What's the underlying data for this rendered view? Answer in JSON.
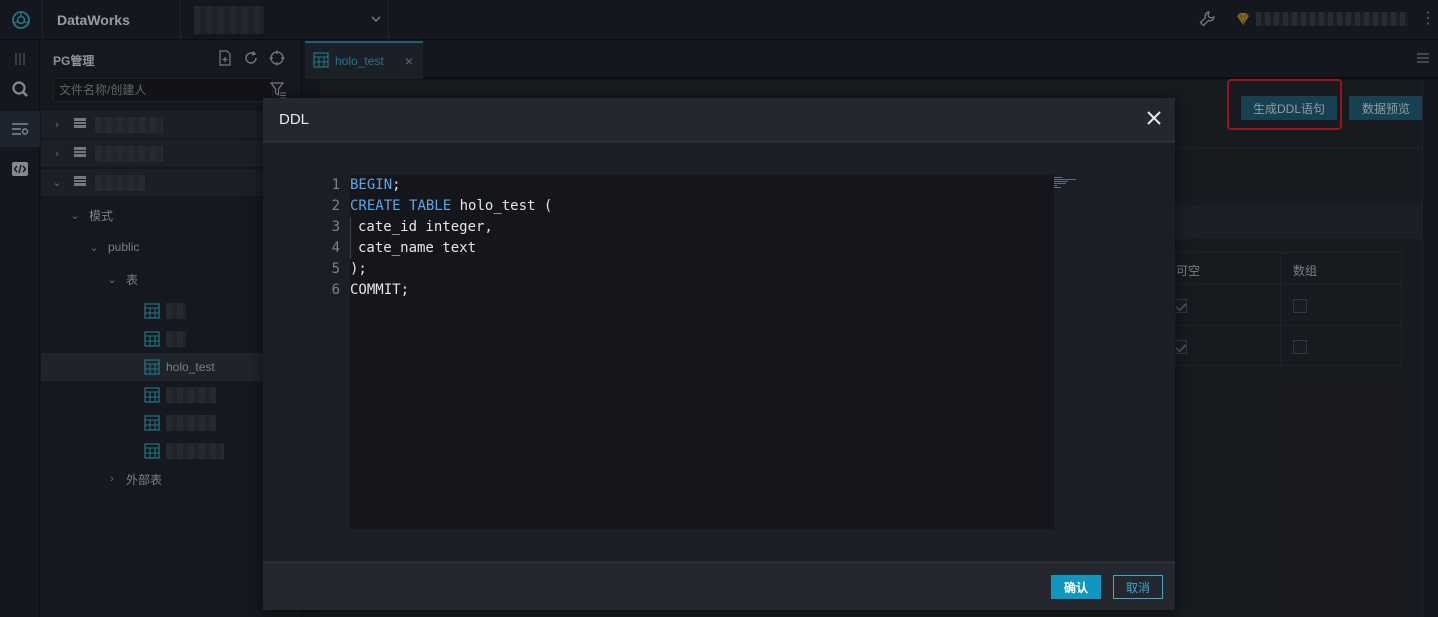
{
  "app": {
    "title": "DataWorks"
  },
  "panel": {
    "title": "PG管理",
    "search_placeholder": "文件名称/创建人",
    "tree": {
      "schema_label": "模式",
      "public_label": "public",
      "tables_label": "表",
      "selected_table": "holo_test",
      "external_label": "外部表"
    }
  },
  "tabs": [
    {
      "label": "holo_test"
    }
  ],
  "toolbar": {
    "generate_ddl_label": "生成DDL语句",
    "data_preview_label": "数据预览"
  },
  "column_table": {
    "headers": [
      "可空",
      "数组"
    ],
    "rows": [
      {
        "nullable": true,
        "array": false
      },
      {
        "nullable": true,
        "array": false
      }
    ]
  },
  "modal": {
    "title": "DDL",
    "code_lines": [
      {
        "num": "1",
        "parts": [
          {
            "t": "BEGIN",
            "k": true
          },
          {
            "t": ";",
            "k": false
          }
        ]
      },
      {
        "num": "2",
        "parts": [
          {
            "t": "CREATE",
            "k": true
          },
          {
            "t": " ",
            "k": false
          },
          {
            "t": "TABLE",
            "k": true
          },
          {
            "t": " holo_test (",
            "k": false
          }
        ]
      },
      {
        "num": "3",
        "parts": [
          {
            "t": "cate_id integer,",
            "k": false
          }
        ],
        "indent": true
      },
      {
        "num": "4",
        "parts": [
          {
            "t": "cate_name text",
            "k": false
          }
        ],
        "indent": true
      },
      {
        "num": "5",
        "parts": [
          {
            "t": ");",
            "k": false
          }
        ]
      },
      {
        "num": "6",
        "parts": [
          {
            "t": "COMMIT;",
            "k": false
          }
        ]
      }
    ],
    "confirm_label": "确认",
    "cancel_label": "取消"
  },
  "colors": {
    "accent": "#0f97c2",
    "keyword": "#56a8e8",
    "highlight": "#e61b23"
  }
}
